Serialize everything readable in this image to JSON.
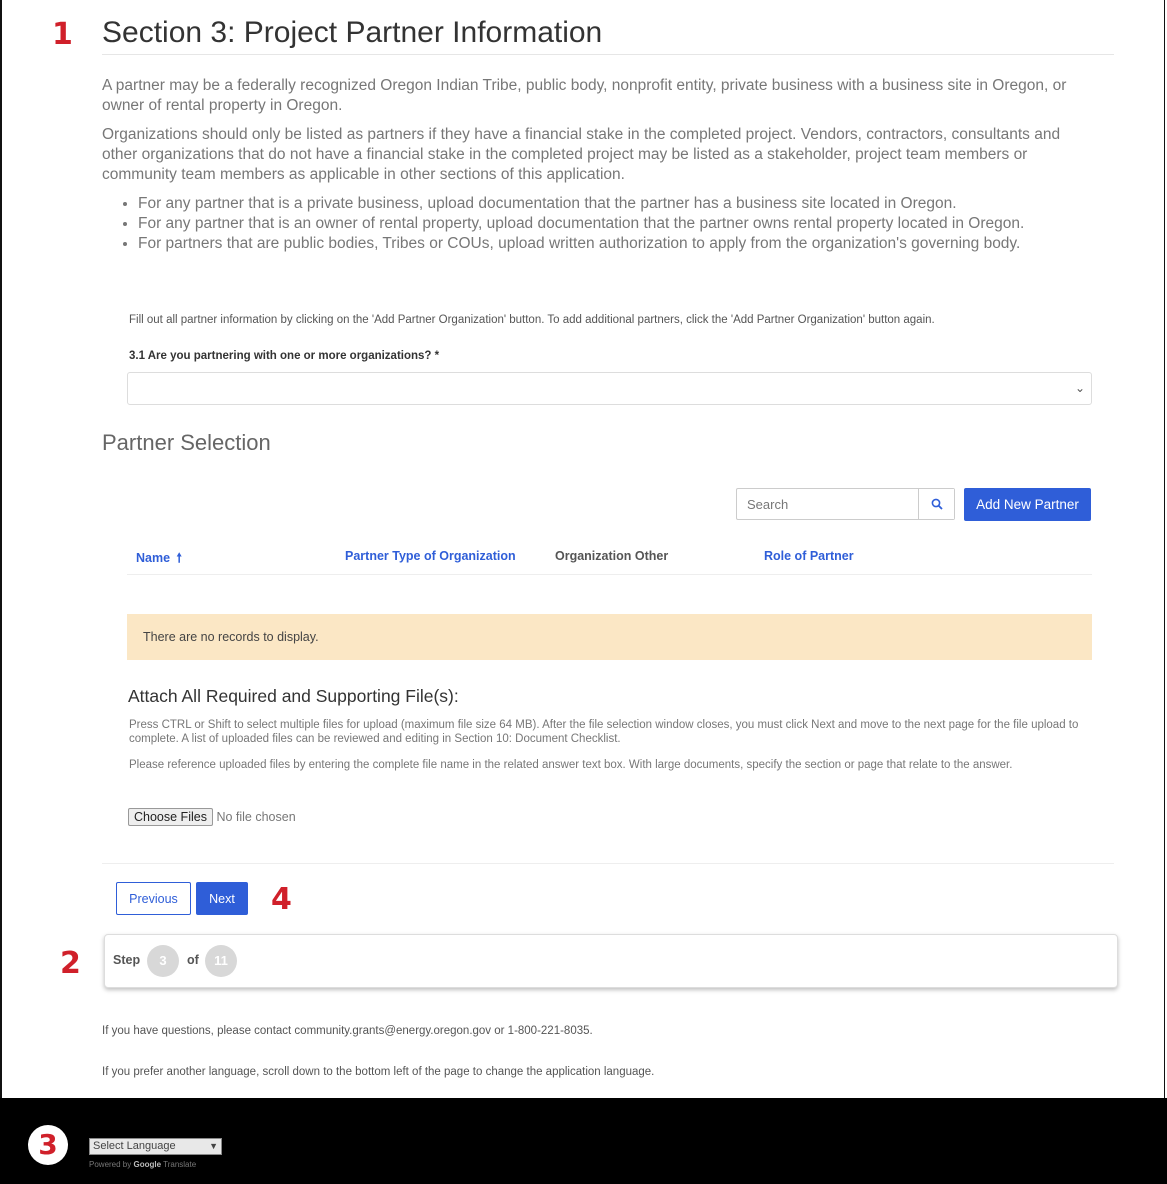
{
  "annotations": {
    "m1": "1",
    "m2": "2",
    "m3": "3",
    "m4": "4"
  },
  "section": {
    "title": "Section 3: Project Partner Information",
    "intro_p1": "A partner may be a federally recognized Oregon Indian Tribe, public body, nonprofit entity, private business with a business site in Oregon, or owner of rental property in Oregon.",
    "intro_p2": "Organizations should only be listed as partners if they have a financial stake in the completed project. Vendors, contractors, consultants and other organizations that do not have a financial stake in the completed project may be listed as a stakeholder, project team members or community team members as applicable in other sections of this application.",
    "bullets": [
      "For any partner that is a private business, upload documentation that the partner has a business site located in Oregon.",
      "For any partner that is an owner of rental property, upload documentation that the partner owns rental property located in Oregon.",
      "For partners that are public bodies, Tribes or COUs, upload written authorization to apply from the organization's governing body."
    ],
    "instructions": "Fill out all partner information by clicking on the 'Add Partner Organization' button. To add additional partners, click the 'Add Partner Organization' button again.",
    "question_label": "3.1 Are you partnering with one or more organizations? *",
    "question_value": ""
  },
  "partner_selection": {
    "heading": "Partner Selection",
    "search_placeholder": "Search",
    "add_button": "Add New Partner",
    "columns": [
      "Name",
      "Partner Type of Organization",
      "Organization Other",
      "Role of Partner"
    ],
    "sort_indicator": "🠕",
    "empty_message": "There are no records to display."
  },
  "attachments": {
    "title": "Attach All Required and Supporting File(s):",
    "text1": "Press CTRL or Shift to select multiple files for upload (maximum file size 64 MB). After the file selection window closes, you must click Next and move to the next page for the file upload to complete. A list of uploaded files can be reviewed and editing in Section 10: Document Checklist.",
    "text2": "Please reference uploaded files by entering the complete file name in the related answer text box. With large documents, specify the section or page that relate to the answer.",
    "choose_button": "Choose Files",
    "no_file": "No file chosen"
  },
  "navigation": {
    "previous": "Previous",
    "next": "Next"
  },
  "progress": {
    "step_label": "Step",
    "current": "3",
    "of_label": "of",
    "total": "11"
  },
  "footer": {
    "contact": "If you have questions, please contact community.grants@energy.oregon.gov or 1-800-221-8035.",
    "language_note": "If you prefer another language, scroll down to the bottom left of the page to change the application language.",
    "language_select": "Select Language",
    "powered_by": "Powered by",
    "google": "Google",
    "translate": "Translate"
  },
  "colors": {
    "accent": "#2f5ed8",
    "annotation_red": "#d0202a",
    "empty_row_bg": "#fbe7c5"
  }
}
